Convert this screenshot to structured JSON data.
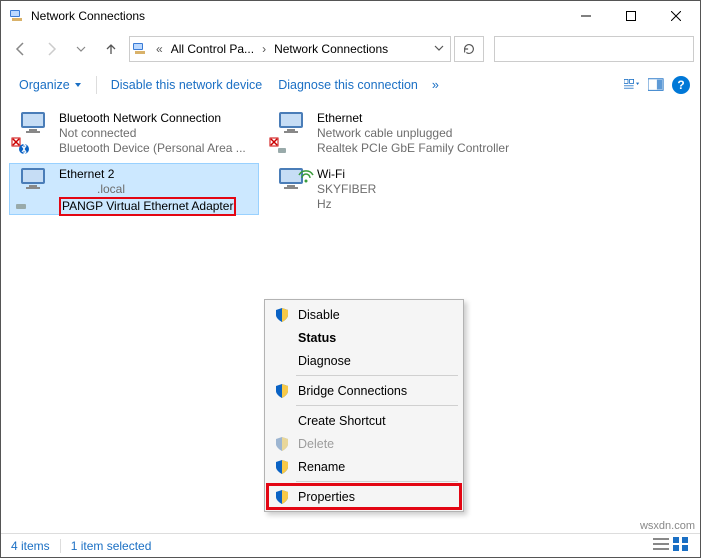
{
  "title": "Network Connections",
  "breadcrumbs": {
    "root": "All Control Pa...",
    "current": "Network Connections"
  },
  "toolbar": {
    "organize": "Organize",
    "disable": "Disable this network device",
    "diagnose": "Diagnose this connection",
    "help": "?"
  },
  "connections": [
    {
      "name": "Bluetooth Network Connection",
      "status": "Not connected",
      "device": "Bluetooth Device (Personal Area ...",
      "overlay": "error-bt"
    },
    {
      "name": "Ethernet",
      "status": "Network cable unplugged",
      "device": "Realtek PCIe GbE Family Controller",
      "overlay": "error"
    },
    {
      "name": "Ethernet 2",
      "status": ".local",
      "device": "PANGP Virtual Ethernet Adapter",
      "overlay": "none"
    },
    {
      "name": "Wi-Fi",
      "status": "SKYFIBER",
      "device": "Hz",
      "overlay": "none"
    }
  ],
  "context_menu": {
    "disable": "Disable",
    "status": "Status",
    "diagnose": "Diagnose",
    "bridge": "Bridge Connections",
    "create_shortcut": "Create Shortcut",
    "delete": "Delete",
    "rename": "Rename",
    "properties": "Properties"
  },
  "statusbar": {
    "count": "4 items",
    "selected": "1 item selected"
  },
  "watermark": "wsxdn.com"
}
